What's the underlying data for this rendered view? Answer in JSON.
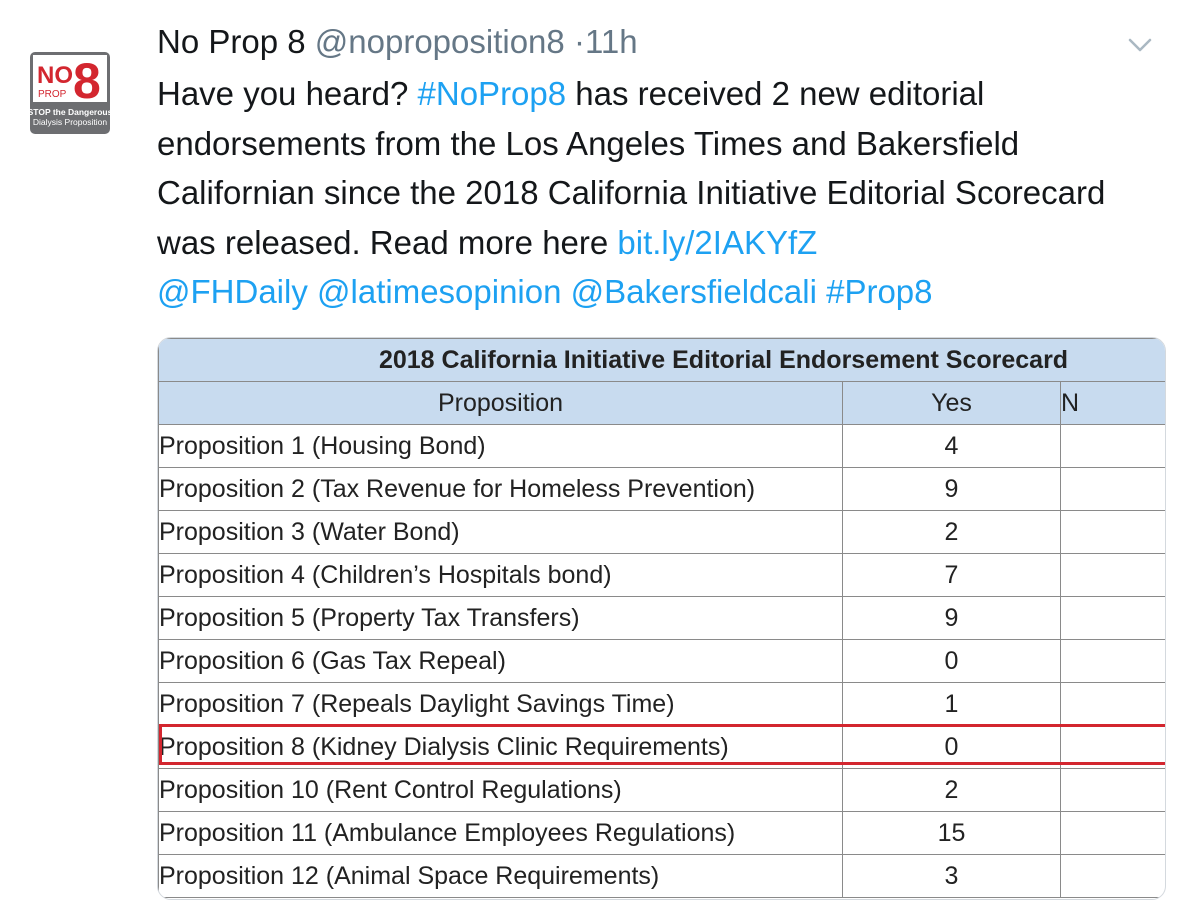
{
  "tweet": {
    "display_name": "No Prop 8",
    "handle": "@noproposition8",
    "separator": "·",
    "time": "11h",
    "text_1": "Have you heard? ",
    "hashtag_1": "#NoProp8",
    "text_2": " has received 2 new editorial endorsements from the Los Angeles Times and Bakersfield Californian since the 2018 California Initiative Editorial Scorecard was released. Read more here ",
    "link": "bit.ly/2IAKYfZ",
    "mention_1": "@FHDaily",
    "mention_2": "@latimesopinion",
    "mention_3": "@Bakersfieldcali",
    "hashtag_2": "#Prop8"
  },
  "avatar": {
    "logo_text_no": "NO",
    "logo_text_8": "8",
    "logo_text_prop": "PROP",
    "logo_text_stop_1": "STOP the Dangerous",
    "logo_text_stop_2": "Dialysis Proposition",
    "red": "#d3262f",
    "gray": "#6d6e71"
  },
  "scorecard": {
    "title": "2018 California Initiative Editorial Endorsement Scorecard",
    "columns": [
      "Proposition",
      "Yes",
      "N"
    ],
    "rows": [
      {
        "name": "Proposition 1 (Housing Bond)",
        "yes": "4"
      },
      {
        "name": "Proposition 2 (Tax Revenue for Homeless Prevention)",
        "yes": "9"
      },
      {
        "name": "Proposition 3 (Water Bond)",
        "yes": "2"
      },
      {
        "name": "Proposition 4 (Children’s Hospitals bond)",
        "yes": "7"
      },
      {
        "name": "Proposition 5 (Property Tax Transfers)",
        "yes": "9"
      },
      {
        "name": "Proposition 6 (Gas Tax Repeal)",
        "yes": "0"
      },
      {
        "name": "Proposition 7 (Repeals Daylight  Savings Time)",
        "yes": "1"
      },
      {
        "name": "Proposition 8 (Kidney Dialysis Clinic Requirements)",
        "yes": "0"
      },
      {
        "name": "Proposition 10 (Rent Control Regulations)",
        "yes": "2"
      },
      {
        "name": "Proposition 11 (Ambulance Employees Regulations)",
        "yes": "15"
      },
      {
        "name": "Proposition 12 (Animal Space Requirements)",
        "yes": "3"
      }
    ],
    "header_bg": "#c8dbef",
    "highlight_color": "#d3262f"
  },
  "colors": {
    "link": "#1da1f2",
    "muted": "#657786"
  }
}
